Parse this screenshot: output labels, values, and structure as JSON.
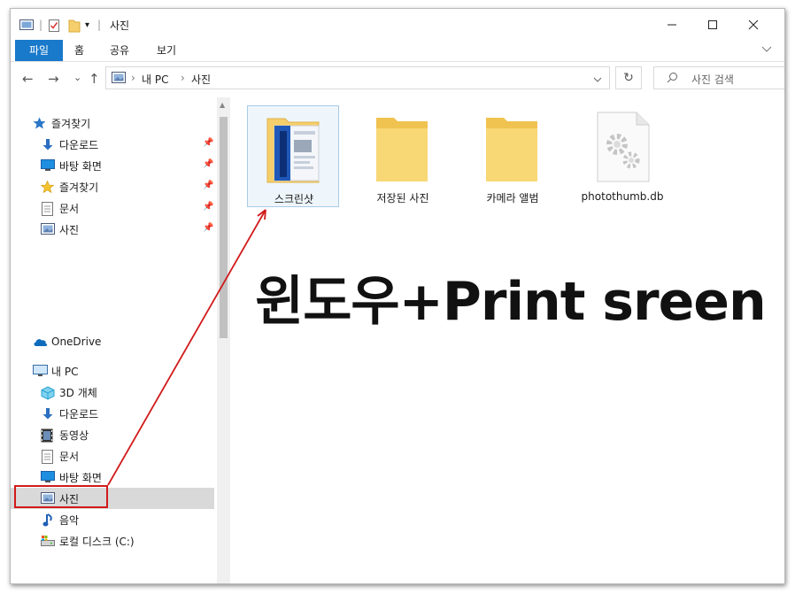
{
  "window": {
    "title": "사진",
    "controls": {
      "minimize": "—",
      "maximize": "☐",
      "close": "✕"
    }
  },
  "ribbon": {
    "tabs": [
      {
        "label": "파일",
        "active": true
      },
      {
        "label": "홈"
      },
      {
        "label": "공유"
      },
      {
        "label": "보기"
      }
    ]
  },
  "navigation": {
    "back": "←",
    "forward": "→",
    "recent": "⌄",
    "up": "↑",
    "address": {
      "segments": [
        "내 PC",
        "사진"
      ]
    },
    "search_placeholder": "사진 검색"
  },
  "sidebar": {
    "quick_access": {
      "label": "즐겨찾기",
      "items": [
        {
          "label": "다운로드",
          "icon": "download-icon",
          "pinned": true
        },
        {
          "label": "바탕 화면",
          "icon": "desktop-icon",
          "pinned": true
        },
        {
          "label": "즐겨찾기",
          "icon": "star-icon",
          "pinned": true
        },
        {
          "label": "문서",
          "icon": "document-icon",
          "pinned": true
        },
        {
          "label": "사진",
          "icon": "pictures-icon",
          "pinned": true
        }
      ]
    },
    "onedrive": {
      "label": "OneDrive"
    },
    "this_pc": {
      "label": "내 PC",
      "items": [
        {
          "label": "3D 개체",
          "icon": "cube-3d-icon"
        },
        {
          "label": "다운로드",
          "icon": "download-icon"
        },
        {
          "label": "동영상",
          "icon": "video-icon"
        },
        {
          "label": "문서",
          "icon": "document-icon"
        },
        {
          "label": "바탕 화면",
          "icon": "desktop-icon"
        },
        {
          "label": "사진",
          "icon": "pictures-icon",
          "selected": true
        },
        {
          "label": "음악",
          "icon": "music-icon"
        },
        {
          "label": "로컬 디스크 (C:)",
          "icon": "local-disk-icon"
        }
      ]
    }
  },
  "files": [
    {
      "name": "스크린샷",
      "type": "folder-with-preview",
      "focused": true
    },
    {
      "name": "저장된 사진",
      "type": "folder"
    },
    {
      "name": "카메라 앨범",
      "type": "folder"
    },
    {
      "name": "photothumb.db",
      "type": "system-file"
    }
  ],
  "overlay_caption": "윈도우+Print sreen",
  "colors": {
    "accent": "#1979ca",
    "annotation": "#d11a1a",
    "folder": "#f5cf6b",
    "selected_bg": "#d9d9d9"
  }
}
